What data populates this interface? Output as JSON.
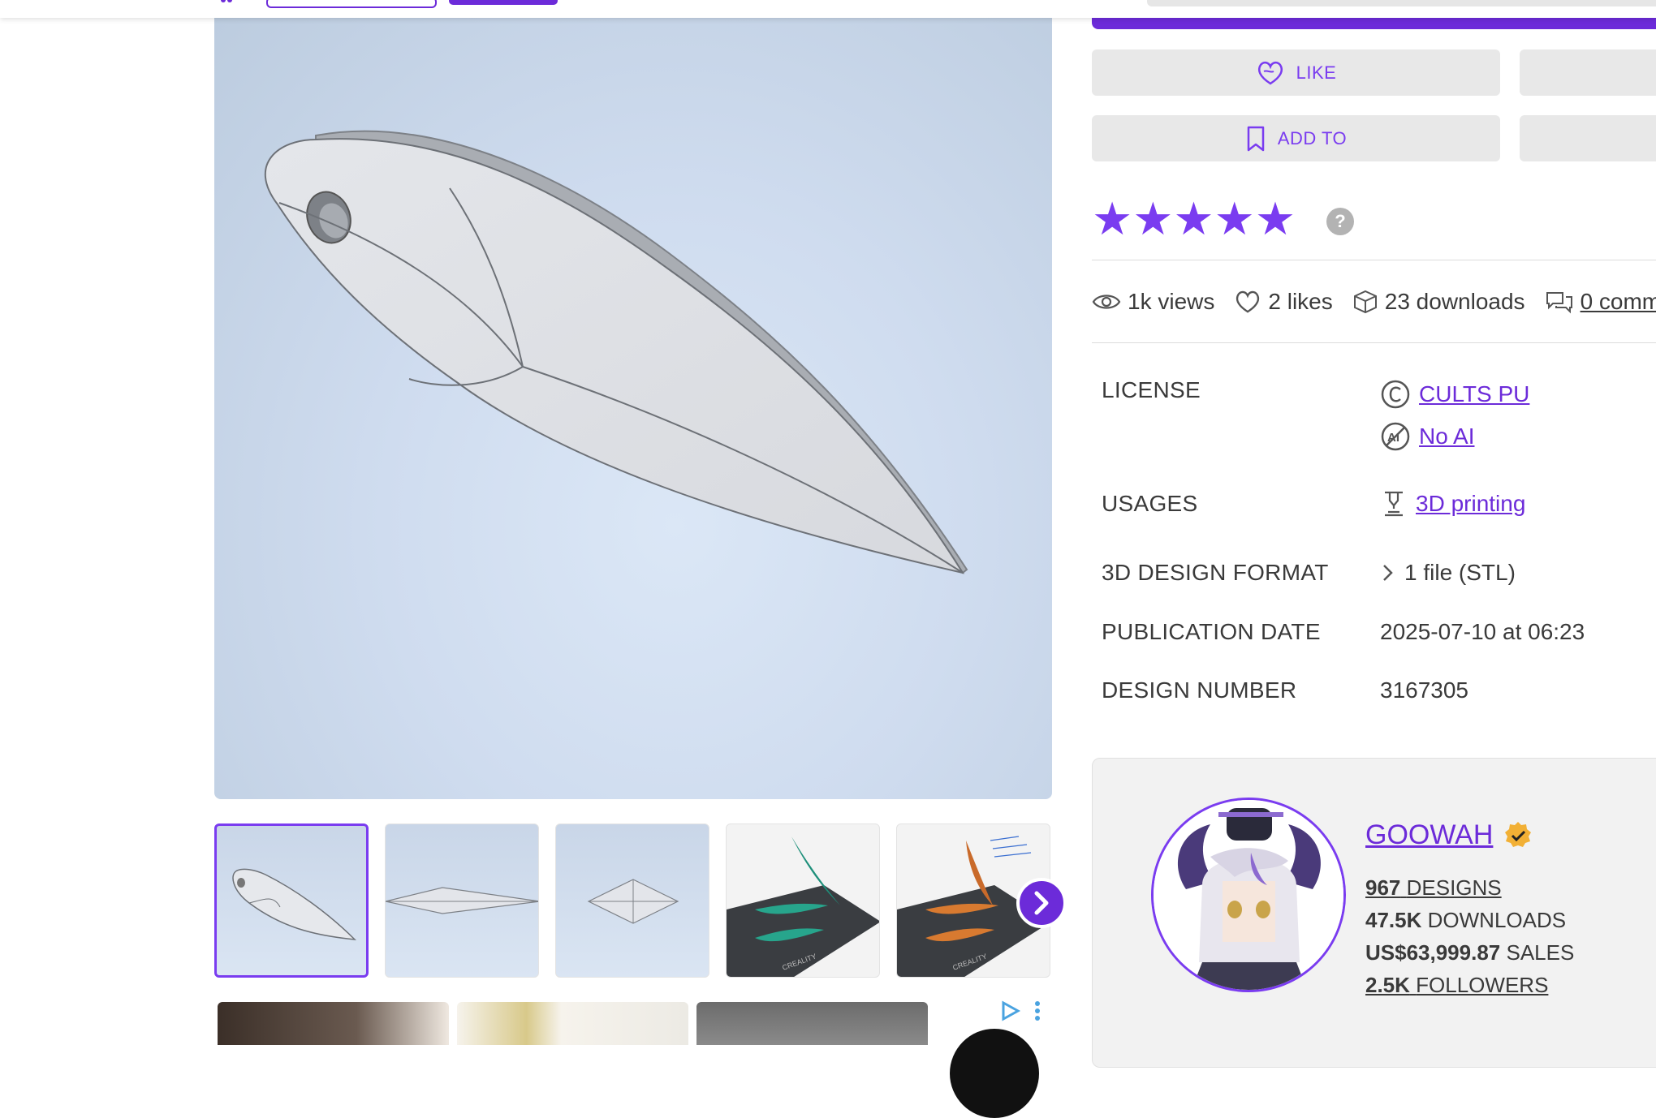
{
  "actions": {
    "like_label": "LIKE",
    "add_to_label": "ADD TO"
  },
  "rating": {
    "stars": "★★★★★",
    "help": "?"
  },
  "stats": {
    "views": "1k views",
    "likes": "2 likes",
    "downloads": "23 downloads",
    "comments": "0 comm"
  },
  "info": {
    "license_label": "LICENSE",
    "license_value": "CULTS PU",
    "ai_value": "No AI",
    "usages_label": "USAGES",
    "usages_value": "3D printing",
    "format_label": "3D DESIGN FORMAT",
    "format_value": "1 file (STL)",
    "date_label": "PUBLICATION DATE",
    "date_value": "2025-07-10 at 06:23",
    "number_label": "DESIGN NUMBER",
    "number_value": "3167305"
  },
  "creator": {
    "name": "GOOWAH",
    "designs_count": "967",
    "designs_label": "DESIGNS",
    "downloads_count": "47.5K",
    "downloads_label": "DOWNLOADS",
    "sales_amount": "US$63,999.87",
    "sales_label": "SALES",
    "followers_count": "2.5K",
    "followers_label": "FOLLOWERS"
  },
  "thumbnail_text": {
    "brand_1": "CREALITY",
    "brand_2": "CREALITY"
  },
  "colors": {
    "accent": "#6c2bd9",
    "star": "#7a3cf0"
  },
  "icons": {
    "like": "heart-icon",
    "add_to": "bookmark-icon",
    "views": "eye-icon",
    "likes": "heart-icon",
    "downloads": "box-icon",
    "comments": "comments-icon",
    "license": "copyright-icon",
    "ai": "no-ai-icon",
    "usages": "printer-icon",
    "format": "chevron-right-icon",
    "verified": "verified-badge-icon",
    "next": "chevron-right-icon"
  }
}
